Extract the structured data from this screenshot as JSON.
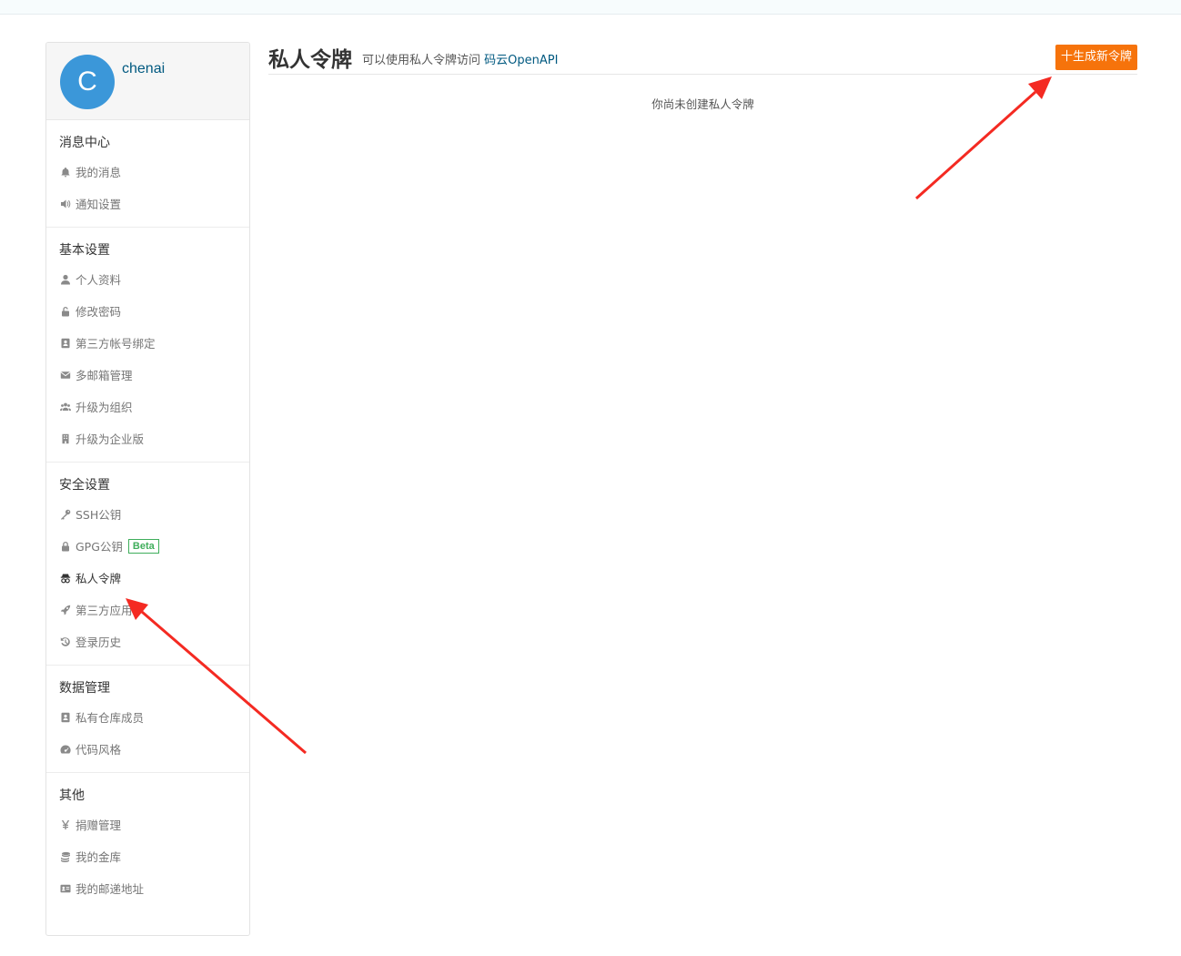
{
  "user": {
    "avatar_letter": "C",
    "name": "chenai"
  },
  "sidebar": {
    "sections": [
      {
        "title": "消息中心",
        "items": [
          {
            "label": "我的消息",
            "icon": "bell-icon"
          },
          {
            "label": "通知设置",
            "icon": "volume-icon"
          }
        ]
      },
      {
        "title": "基本设置",
        "items": [
          {
            "label": "个人资料",
            "icon": "user-icon"
          },
          {
            "label": "修改密码",
            "icon": "unlock-icon"
          },
          {
            "label": "第三方帐号绑定",
            "icon": "contact-card-icon"
          },
          {
            "label": "多邮箱管理",
            "icon": "envelope-icon"
          },
          {
            "label": "升级为组织",
            "icon": "group-icon"
          },
          {
            "label": "升级为企业版",
            "icon": "building-icon"
          }
        ]
      },
      {
        "title": "安全设置",
        "items": [
          {
            "label": "SSH公钥",
            "icon": "key-icon"
          },
          {
            "label": "GPG公钥",
            "icon": "lock-icon",
            "badge": "Beta"
          },
          {
            "label": "私人令牌",
            "icon": "spy-icon",
            "active": true
          },
          {
            "label": "第三方应用",
            "icon": "rocket-icon"
          },
          {
            "label": "登录历史",
            "icon": "history-icon"
          }
        ]
      },
      {
        "title": "数据管理",
        "items": [
          {
            "label": "私有仓库成员",
            "icon": "contact-card-icon"
          },
          {
            "label": "代码风格",
            "icon": "dashboard-icon"
          }
        ]
      },
      {
        "title": "其他",
        "items": [
          {
            "label": "捐赠管理",
            "icon": "yen-icon"
          },
          {
            "label": "我的金库",
            "icon": "coins-icon"
          },
          {
            "label": "我的邮递地址",
            "icon": "address-card-icon"
          }
        ]
      }
    ]
  },
  "main": {
    "title": "私人令牌",
    "subtitle_prefix": "可以使用私人令牌访问 ",
    "subtitle_link": "码云OpenAPI",
    "new_button": "十生成新令牌",
    "empty_text": "你尚未创建私人令牌"
  },
  "colors": {
    "accent": "#f6730b",
    "link": "#005980",
    "avatar": "#3b97d9",
    "annotation_arrow": "#f42a22"
  }
}
